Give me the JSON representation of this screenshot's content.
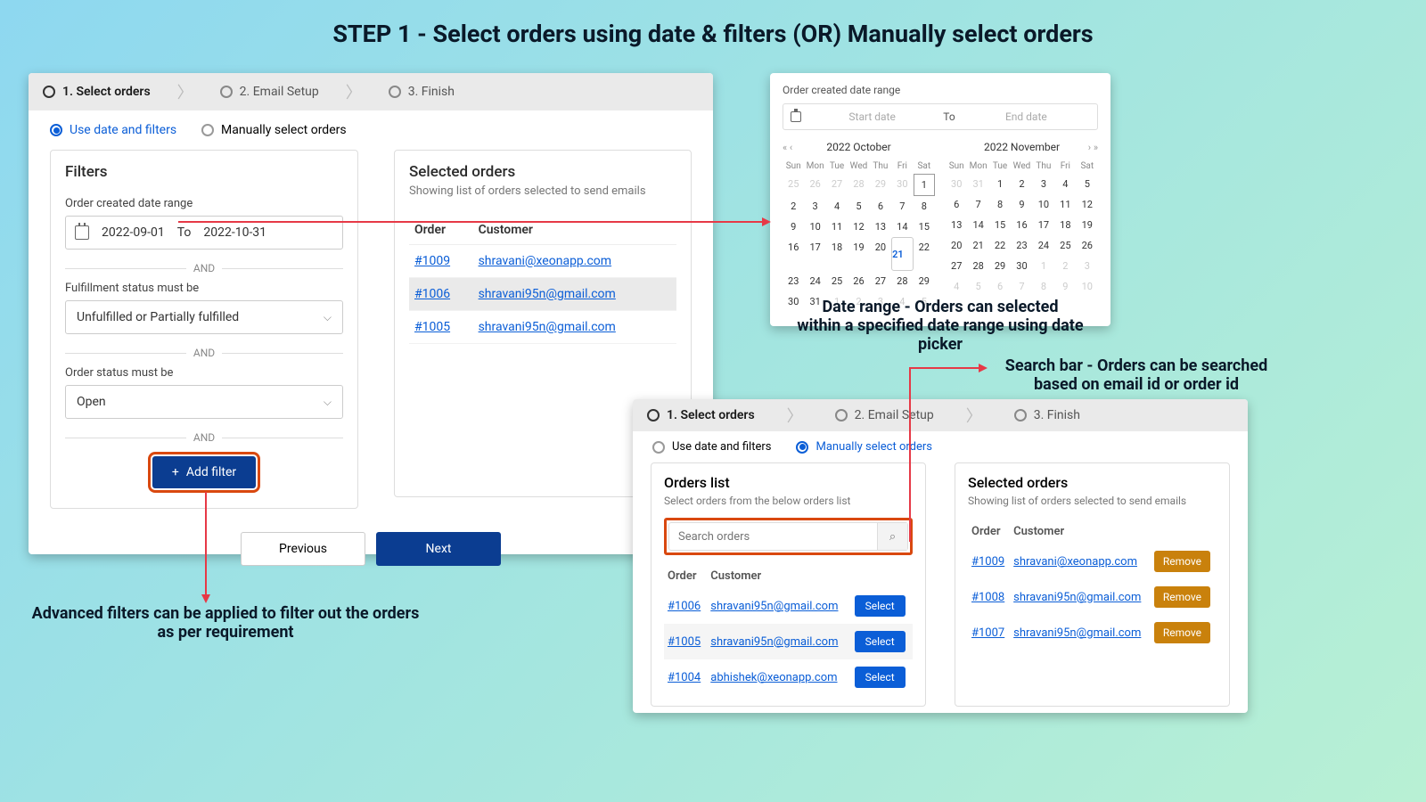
{
  "title": "STEP 1 - Select orders using date & filters (OR) Manually select orders",
  "steps": {
    "s1": "1. Select orders",
    "s2": "2. Email Setup",
    "s3": "3. Finish"
  },
  "mode": {
    "use_filters": "Use date and filters",
    "manual": "Manually select orders"
  },
  "filters": {
    "heading": "Filters",
    "date_label": "Order created date range",
    "start": "2022-09-01",
    "to": "To",
    "end": "2022-10-31",
    "and": "AND",
    "fulfill_label": "Fulfillment status must be",
    "fulfill_value": "Unfulfilled or Partially fulfilled",
    "status_label": "Order status must be",
    "status_value": "Open",
    "add_filter": "Add filter"
  },
  "selected": {
    "heading": "Selected orders",
    "sub": "Showing list of orders selected to send emails",
    "col_order": "Order",
    "col_customer": "Customer",
    "rows": [
      {
        "order": "#1009",
        "cust": "shravani@xeonapp.com"
      },
      {
        "order": "#1006",
        "cust": "shravani95n@gmail.com"
      },
      {
        "order": "#1005",
        "cust": "shravani95n@gmail.com"
      }
    ]
  },
  "nav": {
    "prev": "Previous",
    "next": "Next"
  },
  "calendar": {
    "label": "Order created date range",
    "start_ph": "Start date",
    "to": "To",
    "end_ph": "End date",
    "month1": "2022 October",
    "month2": "2022 November",
    "dow": [
      "Sun",
      "Mon",
      "Tue",
      "Wed",
      "Thu",
      "Fri",
      "Sat"
    ]
  },
  "annot": {
    "date_range": "Date range - Orders can selected\nwithin a specified date range using date picker",
    "search": "Search bar - Orders can be searched\nbased on email id or order id",
    "filters": "Advanced filters can be applied to filter out the orders\nas per requirement"
  },
  "panel2": {
    "orders_heading": "Orders list",
    "orders_sub": "Select orders from the below orders list",
    "search_ph": "Search orders",
    "col_order": "Order",
    "col_customer": "Customer",
    "select": "Select",
    "remove": "Remove",
    "left": [
      {
        "order": "#1006",
        "cust": "shravani95n@gmail.com"
      },
      {
        "order": "#1005",
        "cust": "shravani95n@gmail.com"
      },
      {
        "order": "#1004",
        "cust": "abhishek@xeonapp.com"
      }
    ],
    "right": [
      {
        "order": "#1009",
        "cust": "shravani@xeonapp.com"
      },
      {
        "order": "#1008",
        "cust": "shravani95n@gmail.com"
      },
      {
        "order": "#1007",
        "cust": "shravani95n@gmail.com"
      }
    ]
  }
}
